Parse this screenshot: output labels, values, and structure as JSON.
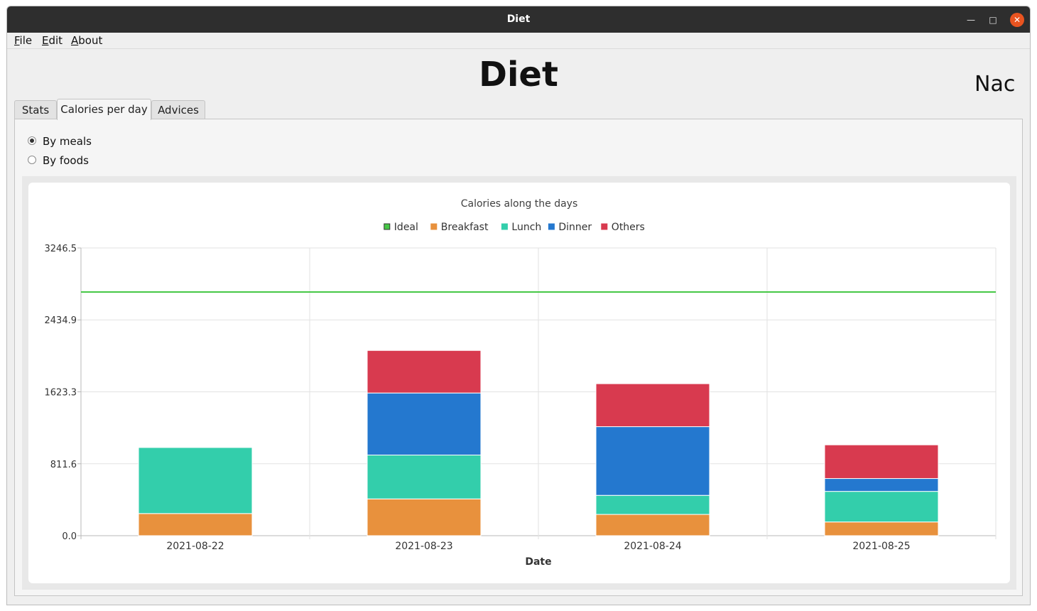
{
  "window": {
    "title": "Diet",
    "minimize_glyph": "—",
    "maximize_glyph": "□",
    "close_glyph": "✕"
  },
  "menu": [
    {
      "accel": "F",
      "rest": "ile"
    },
    {
      "accel": "E",
      "rest": "dit"
    },
    {
      "accel": "A",
      "rest": "bout"
    }
  ],
  "header": {
    "title": "Diet",
    "user": "Nac"
  },
  "tabs": [
    {
      "label": "Stats",
      "active": false
    },
    {
      "label": "Calories per day",
      "active": true
    },
    {
      "label": "Advices",
      "active": false
    }
  ],
  "view_options": [
    {
      "label": "By meals",
      "checked": true
    },
    {
      "label": "By foods",
      "checked": false
    }
  ],
  "chart_data": {
    "type": "bar",
    "stacked": true,
    "title": "Calories along the days",
    "xlabel": "Date",
    "ylabel": "",
    "ylim": [
      0,
      3246.5
    ],
    "yticks": [
      "3246.5",
      "2434.9",
      "1623.3",
      "811.6",
      "0.0"
    ],
    "ytick_values": [
      3246.5,
      2434.9,
      1623.3,
      811.6,
      0.0
    ],
    "categories": [
      "2021-08-22",
      "2021-08-23",
      "2021-08-24",
      "2021-08-25"
    ],
    "ideal": {
      "name": "Ideal",
      "value": 2750,
      "color": "#46c846"
    },
    "series": [
      {
        "name": "Breakfast",
        "color": "#e8913d",
        "values": [
          250,
          415,
          240,
          155
        ]
      },
      {
        "name": "Lunch",
        "color": "#33ceab",
        "values": [
          745,
          495,
          215,
          345
        ]
      },
      {
        "name": "Dinner",
        "color": "#2478cf",
        "values": [
          0,
          700,
          775,
          145
        ]
      },
      {
        "name": "Others",
        "color": "#d83a4f",
        "values": [
          0,
          480,
          485,
          380
        ]
      }
    ],
    "legend_position": "top",
    "grid": true
  }
}
